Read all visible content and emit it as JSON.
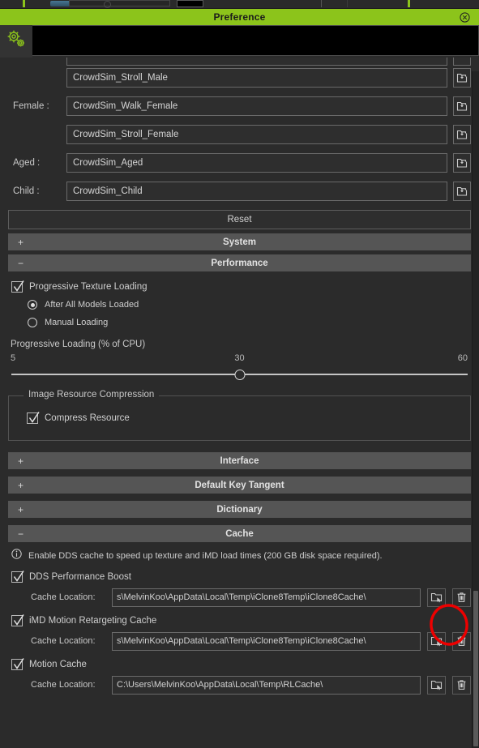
{
  "window": {
    "title": "Preference",
    "close_icon": "close-circle-icon",
    "tab_icon": "gears-icon"
  },
  "crowd_fields": [
    {
      "label": "",
      "value": "",
      "partial": true,
      "load_icon": "folder-load-icon"
    },
    {
      "label": "",
      "value": "CrowdSim_Stroll_Male",
      "load_icon": "folder-load-icon"
    },
    {
      "label": "Female :",
      "value": "CrowdSim_Walk_Female",
      "load_icon": "folder-load-icon"
    },
    {
      "label": "",
      "value": "CrowdSim_Stroll_Female",
      "load_icon": "folder-load-icon"
    },
    {
      "label": "Aged :",
      "value": "CrowdSim_Aged",
      "load_icon": "folder-load-icon"
    },
    {
      "label": "Child :",
      "value": "CrowdSim_Child",
      "load_icon": "folder-load-icon"
    }
  ],
  "reset_button": "Reset",
  "sections": {
    "system": {
      "label": "System",
      "state": "+"
    },
    "performance": {
      "label": "Performance",
      "state": "−"
    },
    "interface": {
      "label": "Interface",
      "state": "+"
    },
    "default_key_tangent": {
      "label": "Default Key Tangent",
      "state": "+"
    },
    "dictionary": {
      "label": "Dictionary",
      "state": "+"
    },
    "cache": {
      "label": "Cache",
      "state": "−"
    }
  },
  "performance": {
    "progressive_texture_loading": {
      "label": "Progressive Texture Loading",
      "checked": true
    },
    "radios": [
      {
        "label": "After All Models Loaded",
        "selected": true
      },
      {
        "label": "Manual Loading",
        "selected": false
      }
    ],
    "slider": {
      "label": "Progressive Loading (% of CPU)",
      "min": "5",
      "value": "30",
      "max": "60"
    },
    "image_resource_compression": {
      "title": "Image Resource Compression",
      "compress_resource": {
        "label": "Compress Resource",
        "checked": true
      }
    }
  },
  "cache": {
    "info_icon": "info-circle-icon",
    "info_text": "Enable DDS cache to speed up texture and iMD load times (200 GB disk space required).",
    "items": [
      {
        "label": "DDS Performance Boost",
        "checked": true,
        "cache_location_label": "Cache Location:",
        "cache_location_value": "s\\MelvinKoo\\AppData\\Local\\Temp\\iClone8Temp\\iClone8Cache\\",
        "browse_icon": "folder-browse-icon",
        "delete_icon": "trash-icon",
        "highlighted": true
      },
      {
        "label": "iMD Motion Retargeting Cache",
        "checked": true,
        "cache_location_label": "Cache Location:",
        "cache_location_value": "s\\MelvinKoo\\AppData\\Local\\Temp\\iClone8Temp\\iClone8Cache\\",
        "browse_icon": "folder-browse-icon",
        "delete_icon": "trash-icon",
        "highlighted": false
      },
      {
        "label": "Motion Cache",
        "checked": true,
        "cache_location_label": "Cache Location:",
        "cache_location_value": "C:\\Users\\MelvinKoo\\AppData\\Local\\Temp\\RLCache\\",
        "browse_icon": "folder-browse-icon",
        "delete_icon": "trash-icon",
        "highlighted": false
      }
    ]
  },
  "annotation": {
    "shape": "red-ellipse-highlight",
    "color": "#ee0000"
  },
  "colors": {
    "accent": "#8cc41b",
    "dialog_bg": "#2b2b2b",
    "section_header": "#555555",
    "field_bg": "#2e2e2e",
    "annotation_red": "#ee0000"
  }
}
